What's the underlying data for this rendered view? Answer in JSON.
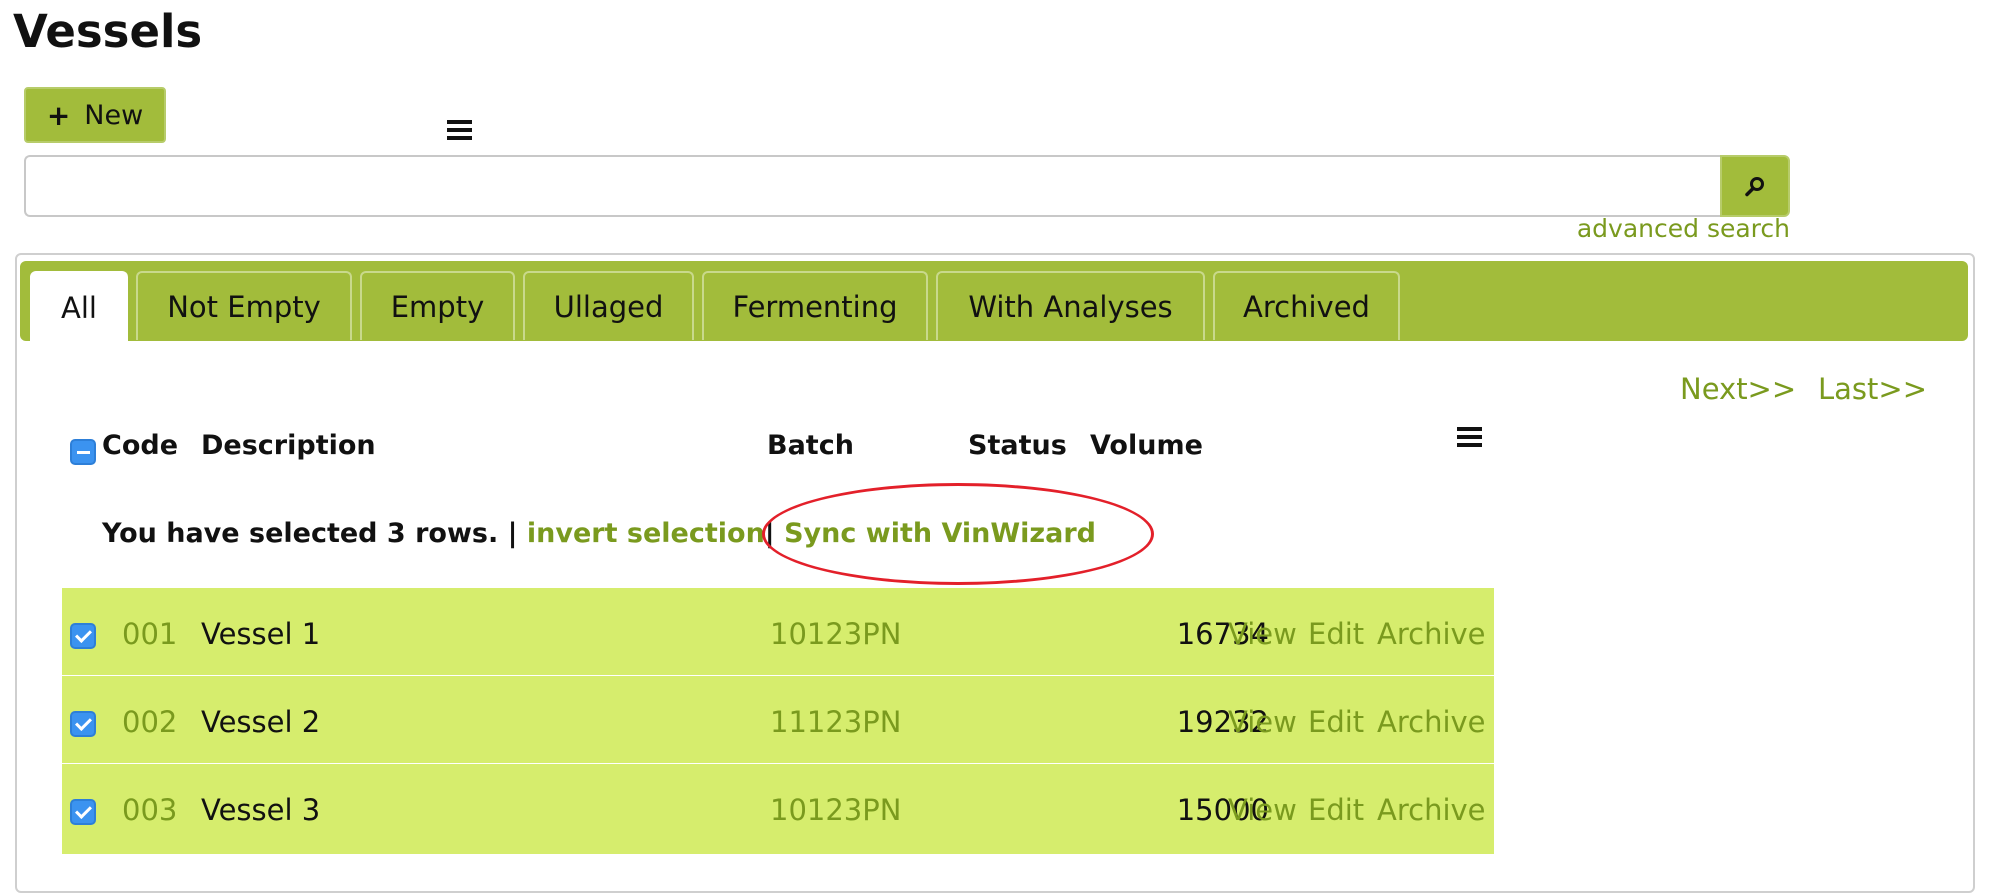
{
  "page": {
    "title": "Vessels"
  },
  "toolbar": {
    "new_label": "New",
    "new_icon": "plus-icon"
  },
  "search": {
    "value": "",
    "placeholder": "",
    "advanced_label": "advanced search"
  },
  "tabs": [
    {
      "label": "All",
      "active": true
    },
    {
      "label": "Not Empty"
    },
    {
      "label": "Empty"
    },
    {
      "label": "Ullaged"
    },
    {
      "label": "Fermenting"
    },
    {
      "label": "With Analyses"
    },
    {
      "label": "Archived"
    }
  ],
  "pager": {
    "next": "Next>>",
    "last": "Last>>"
  },
  "table": {
    "columns": {
      "code": "Code",
      "description": "Description",
      "batch": "Batch",
      "status": "Status",
      "volume": "Volume"
    },
    "selection": {
      "message": "You have selected 3 rows. |",
      "invert": "invert selection",
      "separator": "|",
      "sync": "Sync with VinWizard"
    },
    "rows": [
      {
        "code": "001",
        "description": "Vessel 1",
        "batch": "10123PN",
        "status": "",
        "volume": "16734",
        "checked": true,
        "actions": {
          "view": "View",
          "edit": "Edit",
          "archive": "Archive"
        }
      },
      {
        "code": "002",
        "description": "Vessel 2",
        "batch": "11123PN",
        "status": "",
        "volume": "19232",
        "checked": true,
        "actions": {
          "view": "View",
          "edit": "Edit",
          "archive": "Archive"
        }
      },
      {
        "code": "003",
        "description": "Vessel 3",
        "batch": "10123PN",
        "status": "",
        "volume": "15000",
        "checked": true,
        "actions": {
          "view": "View",
          "edit": "Edit",
          "archive": "Archive"
        }
      }
    ]
  },
  "colors": {
    "accent": "#a2bc3b",
    "link": "#7a9a1e",
    "row_selected": "#d6ed6d",
    "checkbox": "#3b93f0",
    "highlight_ellipse": "#e3202a"
  }
}
